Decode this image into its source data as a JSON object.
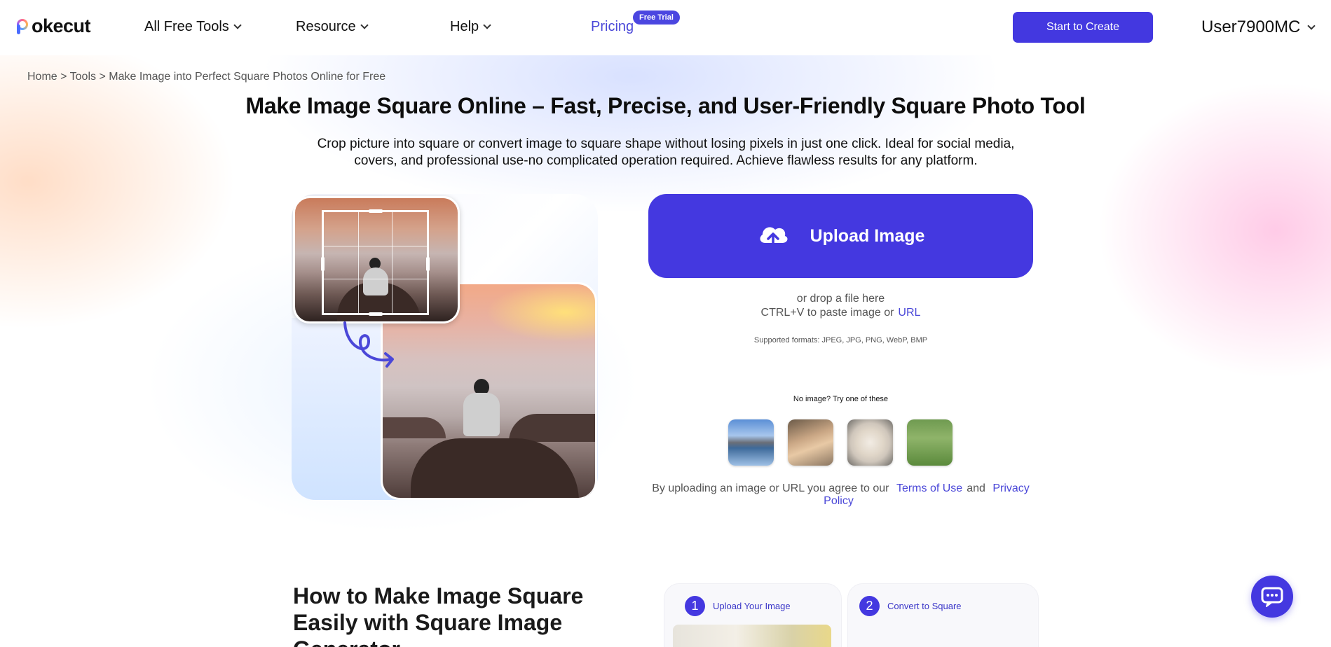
{
  "header": {
    "logo_text": "okecut",
    "nav": [
      {
        "label": "All Free Tools"
      },
      {
        "label": "Resource"
      },
      {
        "label": "Help"
      },
      {
        "label": "Pricing",
        "badge": "Free Trial"
      }
    ],
    "start_button": "Start to Create",
    "user_name": "User7900MC"
  },
  "breadcrumb": {
    "home": "Home",
    "sep": ">",
    "tools": "Tools",
    "current": "Make Image into Perfect Square Photos Online for Free"
  },
  "hero": {
    "title": "Make Image Square Online – Fast, Precise, and User-Friendly Square Photo Tool",
    "subtitle": "Crop picture into square or convert image to square shape without losing pixels in just one click. Ideal for social media, covers, and professional use-no complicated operation required. Achieve flawless results for any platform."
  },
  "upload": {
    "button_label": "Upload Image",
    "drop_text": "or drop a file here",
    "paste_text": "CTRL+V to paste image or",
    "url_link": "URL",
    "formats": "Supported formats: JPEG, JPG, PNG, WebP, BMP",
    "try_text": "No image? Try one of these",
    "terms_prefix": "By uploading an image or URL you agree to our",
    "terms_link": "Terms of Use",
    "and": "and",
    "privacy_link": "Privacy Policy"
  },
  "howto": {
    "title": "How to Make Image Square Easily with Square Image Generator",
    "steps": [
      {
        "num": "1",
        "label": "Upload Your Image"
      },
      {
        "num": "2",
        "label": "Convert to Square"
      }
    ]
  },
  "colors": {
    "accent": "#4438e0",
    "link": "#4a47d8"
  }
}
